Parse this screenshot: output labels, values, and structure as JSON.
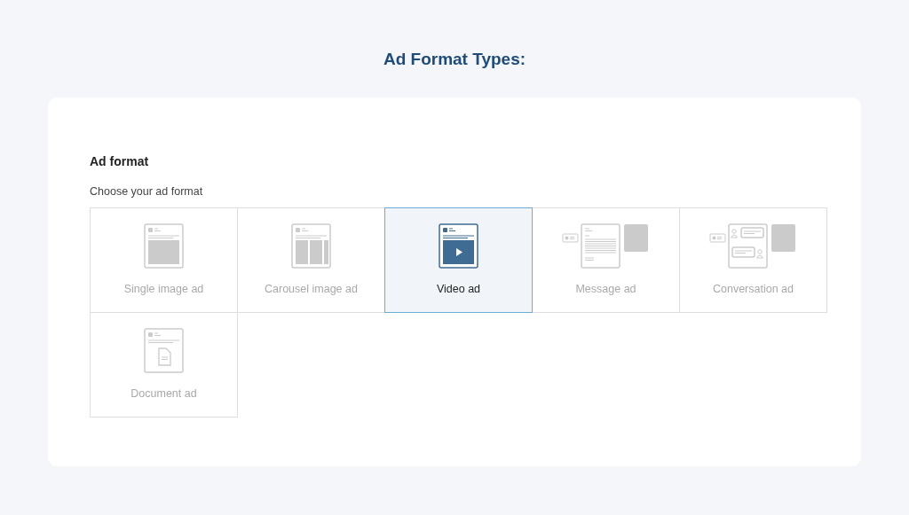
{
  "heading": "Ad Format Types:",
  "section": {
    "title": "Ad format",
    "subtitle": "Choose your ad format"
  },
  "formats": [
    {
      "label": "Single image ad",
      "kind": "single",
      "selected": false
    },
    {
      "label": "Carousel image ad",
      "kind": "carousel",
      "selected": false
    },
    {
      "label": "Video ad",
      "kind": "video",
      "selected": true
    },
    {
      "label": "Message ad",
      "kind": "message",
      "selected": false
    },
    {
      "label": "Conversation ad",
      "kind": "conversation",
      "selected": false
    },
    {
      "label": "Document ad",
      "kind": "document",
      "selected": false
    }
  ]
}
